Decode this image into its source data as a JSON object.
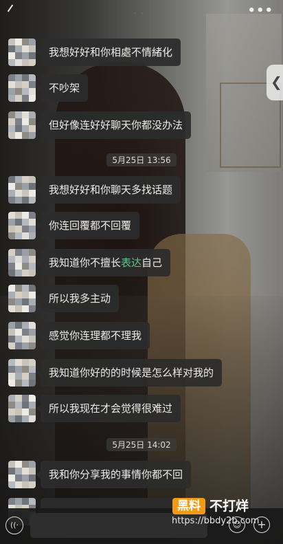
{
  "header": {
    "more_icon": "more-icon"
  },
  "side_handle": {
    "glyph": "❮"
  },
  "messages": [
    {
      "text": "我想好好和你相處不情緒化"
    },
    {
      "text": "不吵架"
    },
    {
      "text": "但好像连好好聊天你都没办法"
    },
    {
      "text": "我想好好和你聊天多找话题"
    },
    {
      "text": "你连回覆都不回覆"
    },
    {
      "text_before": "我知道你不擅长",
      "highlight": "表达",
      "text_after": "自己"
    },
    {
      "text": "所以我多主动"
    },
    {
      "text": "感觉你连理都不理我"
    },
    {
      "text": "我知道你好的的时候是怎么样对我的"
    },
    {
      "text": "所以我现在才会觉得很难过"
    },
    {
      "text": "我和你分享我的事情你都不回"
    }
  ],
  "timestamps": [
    "5月25日 13:56",
    "5月25日 14:02"
  ],
  "bottom_bar": {
    "voice_glyph": "((·",
    "emoji_glyph": "☺",
    "plus_glyph": "+"
  },
  "watermark": {
    "badge": "黑料",
    "text": "不打烊",
    "url": "https://bbdy2b.com"
  },
  "colors": {
    "bubble": "#2c2c2c",
    "highlight": "#5fc38a",
    "watermark_badge": "#f39a14"
  }
}
